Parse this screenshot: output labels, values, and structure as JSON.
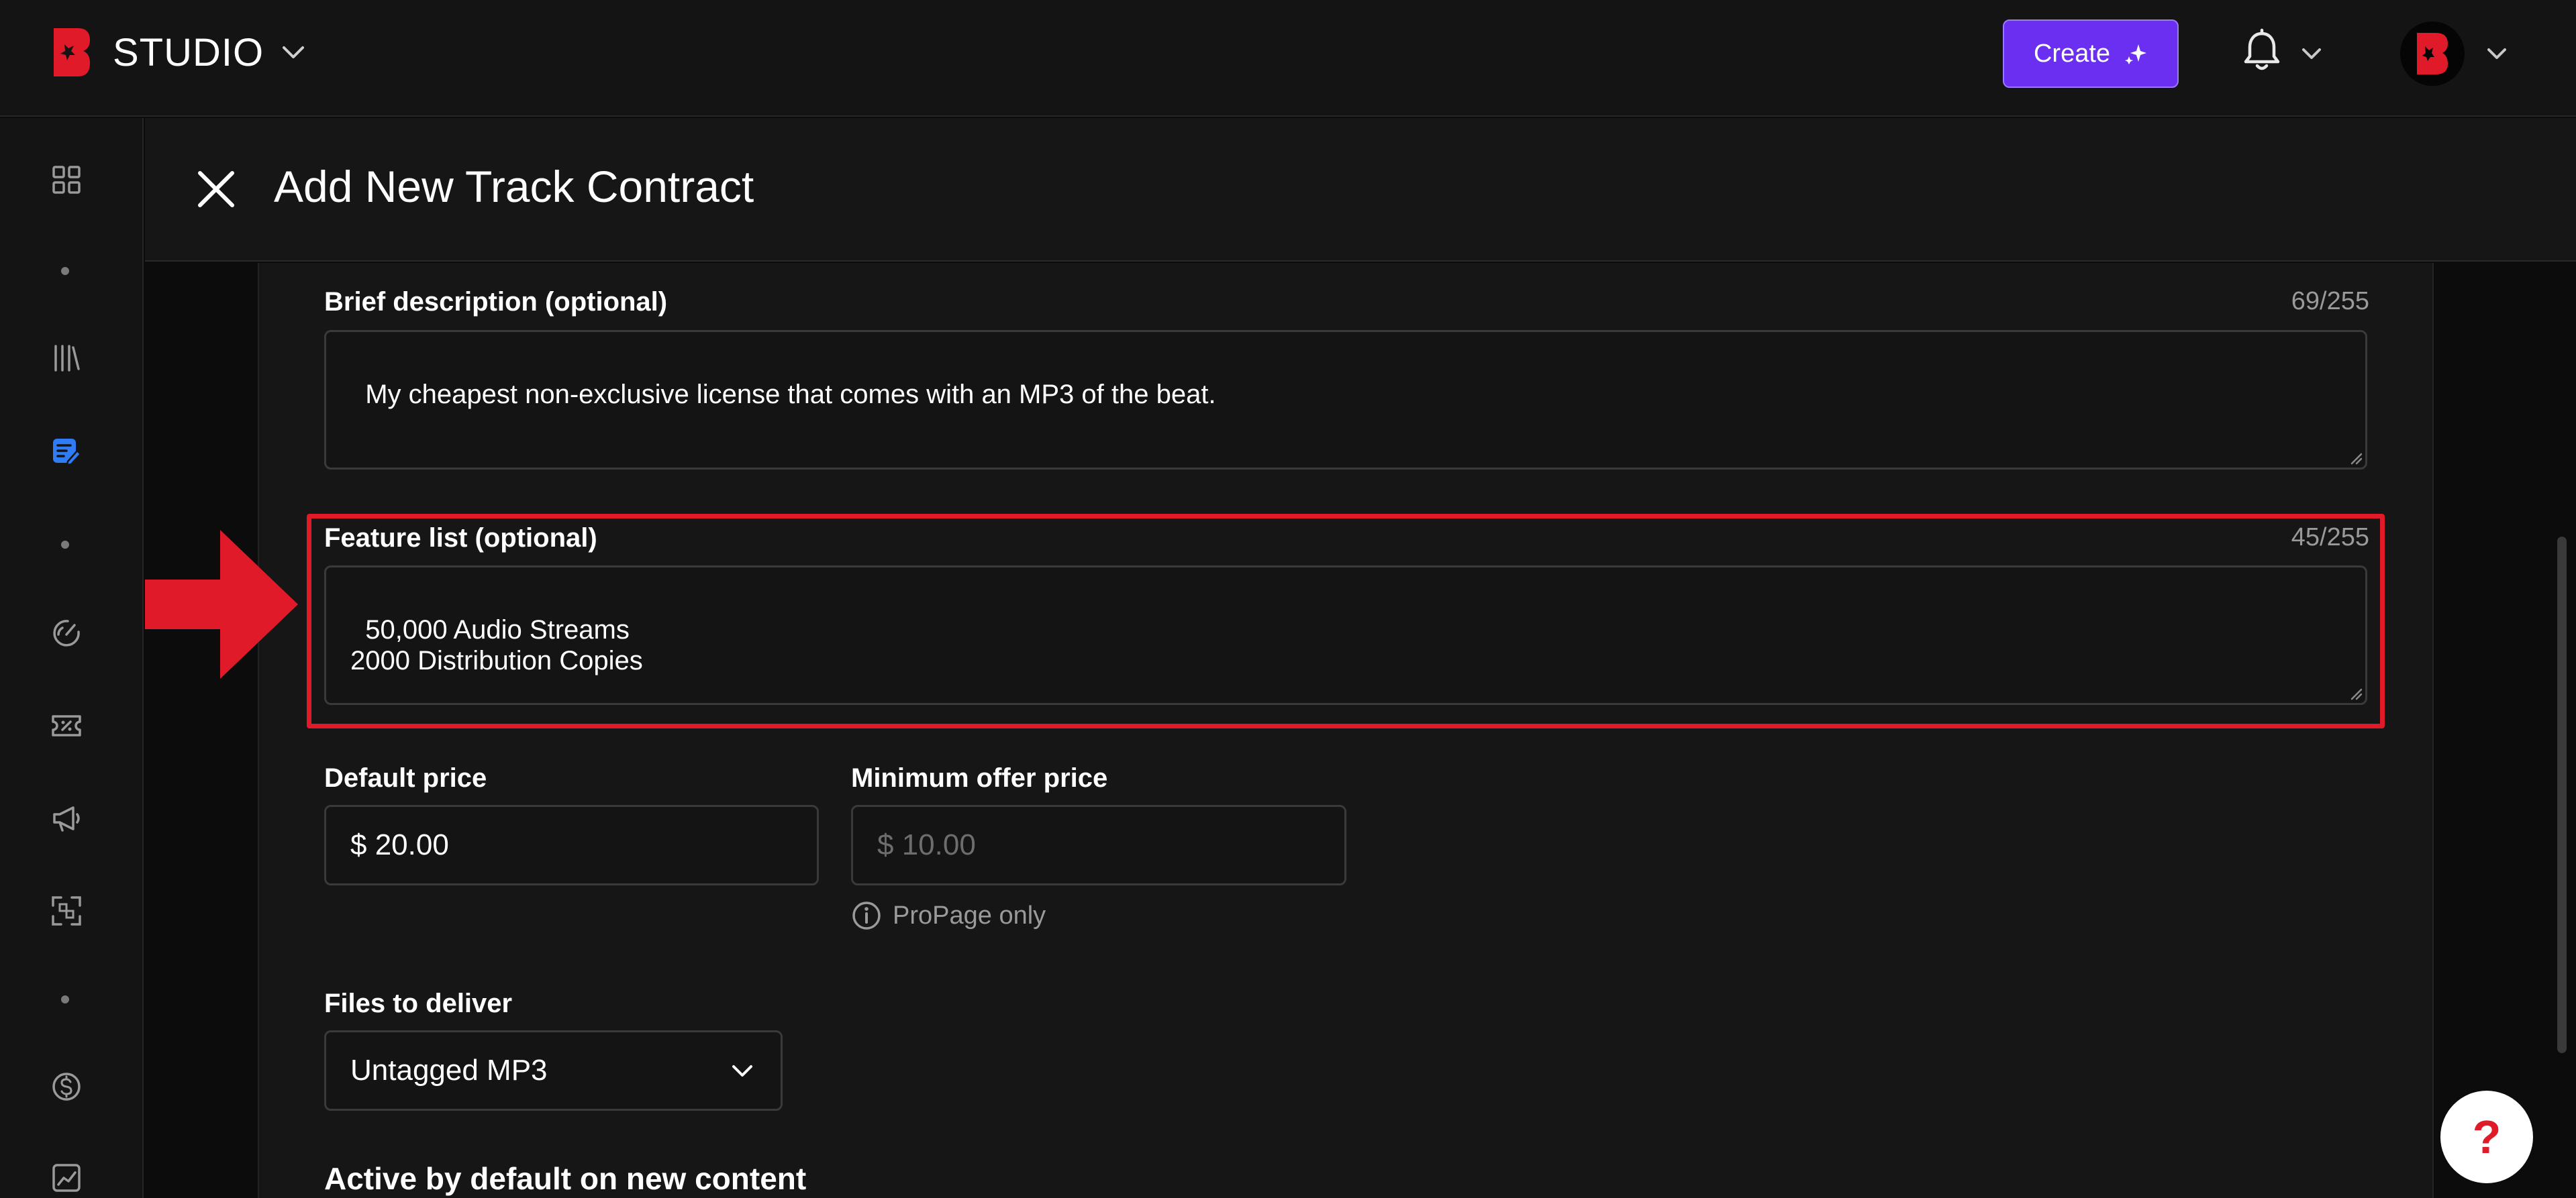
{
  "app": {
    "brand_name": "STUDIO",
    "create_label": "Create",
    "accent_color": "#6a2ff0",
    "brand_color": "#e11a2a"
  },
  "sidebar": {
    "items": [
      {
        "icon": "grid-icon"
      },
      {
        "icon": "library-icon"
      },
      {
        "icon": "contract-icon",
        "active": true
      },
      {
        "icon": "gauge-icon"
      },
      {
        "icon": "voucher-icon"
      },
      {
        "icon": "megaphone-icon"
      },
      {
        "icon": "collab-icon"
      },
      {
        "icon": "dollar-icon"
      },
      {
        "icon": "analytics-icon"
      }
    ]
  },
  "panel": {
    "title": "Add New Track Contract"
  },
  "form": {
    "description": {
      "label": "Brief description (optional)",
      "counter": "69/255",
      "value": "My cheapest non-exclusive license that comes with an MP3 of the beat."
    },
    "features": {
      "label": "Feature list (optional)",
      "counter": "45/255",
      "value": "50,000 Audio Streams\n2000 Distribution Copies"
    },
    "default_price": {
      "label": "Default price",
      "value": "$ 20.00"
    },
    "min_offer": {
      "label": "Minimum offer price",
      "placeholder": "$ 10.00",
      "note": "ProPage only"
    },
    "files": {
      "label": "Files to deliver",
      "selected": "Untagged MP3"
    },
    "active_title": "Active by default on new content"
  },
  "help": {
    "label": "?"
  }
}
